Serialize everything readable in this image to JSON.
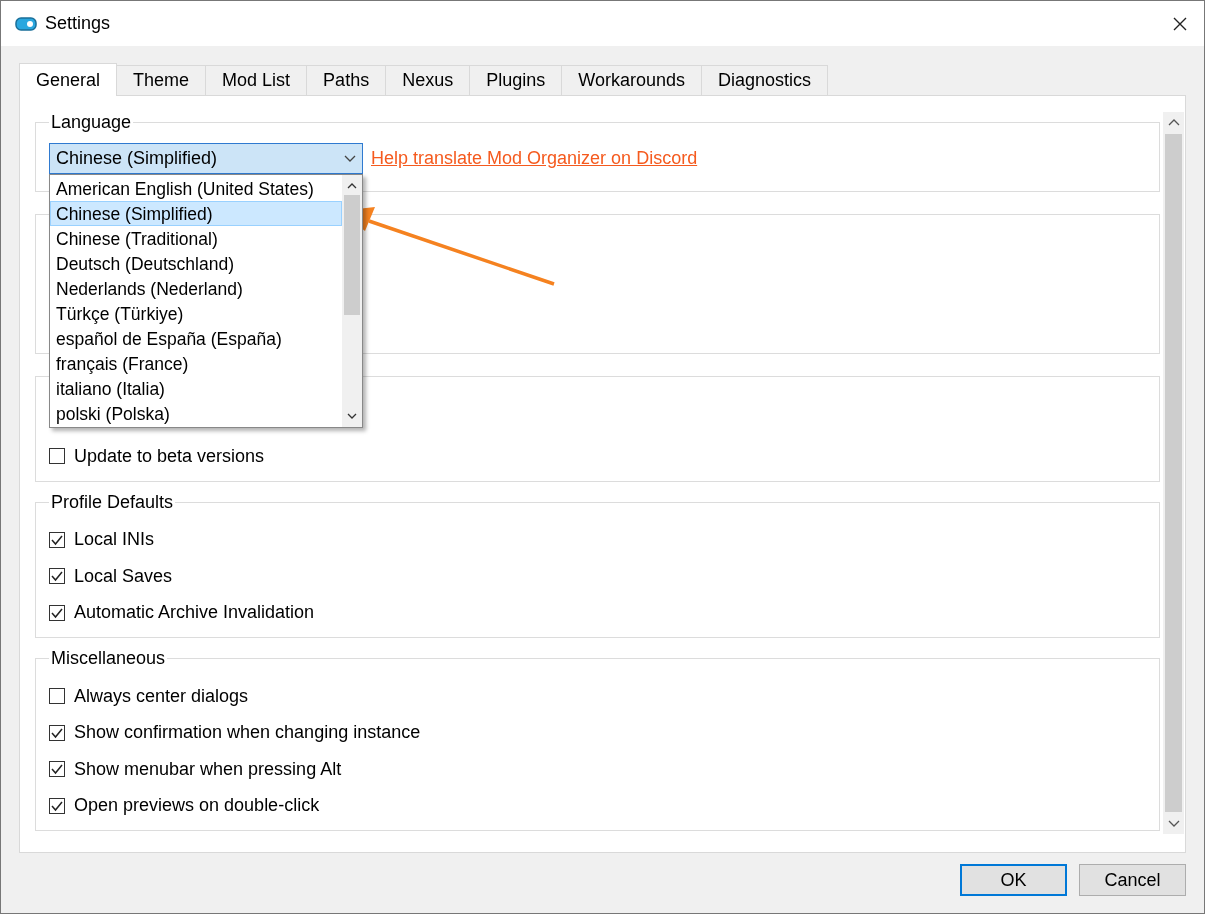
{
  "window": {
    "title": "Settings"
  },
  "tabs": [
    {
      "label": "General",
      "selected": true
    },
    {
      "label": "Theme",
      "selected": false
    },
    {
      "label": "Mod List",
      "selected": false
    },
    {
      "label": "Paths",
      "selected": false
    },
    {
      "label": "Nexus",
      "selected": false
    },
    {
      "label": "Plugins",
      "selected": false
    },
    {
      "label": "Workarounds",
      "selected": false
    },
    {
      "label": "Diagnostics",
      "selected": false
    }
  ],
  "language": {
    "title": "Language",
    "combo": {
      "value": "Chinese (Simplified)",
      "expanded": true
    },
    "link": "Help translate Mod Organizer on Discord",
    "options": [
      {
        "label": "American English (United States)",
        "selected": false
      },
      {
        "label": "Chinese (Simplified)",
        "selected": true
      },
      {
        "label": "Chinese (Traditional)",
        "selected": false
      },
      {
        "label": "Deutsch (Deutschland)",
        "selected": false
      },
      {
        "label": "Nederlands (Nederland)",
        "selected": false
      },
      {
        "label": "Türkçe (Türkiye)",
        "selected": false
      },
      {
        "label": "español de España (España)",
        "selected": false
      },
      {
        "label": "français (France)",
        "selected": false
      },
      {
        "label": "italiano (Italia)",
        "selected": false
      },
      {
        "label": "polski (Polska)",
        "selected": false
      }
    ]
  },
  "update_group": {
    "checkboxes": [
      {
        "label": "Update to beta versions",
        "checked": false
      }
    ]
  },
  "profile_defaults": {
    "title": "Profile Defaults",
    "checkboxes": [
      {
        "label": "Local INIs",
        "checked": true
      },
      {
        "label": "Local Saves",
        "checked": true
      },
      {
        "label": "Automatic Archive Invalidation",
        "checked": true
      }
    ]
  },
  "miscellaneous": {
    "title": "Miscellaneous",
    "checkboxes": [
      {
        "label": "Always center dialogs",
        "checked": false
      },
      {
        "label": "Show confirmation when changing instance",
        "checked": true
      },
      {
        "label": "Show menubar when pressing Alt",
        "checked": true
      },
      {
        "label": "Open previews on double-click",
        "checked": true
      }
    ]
  },
  "buttons": [
    {
      "label": "OK",
      "default": true
    },
    {
      "label": "Cancel",
      "default": false
    }
  ]
}
